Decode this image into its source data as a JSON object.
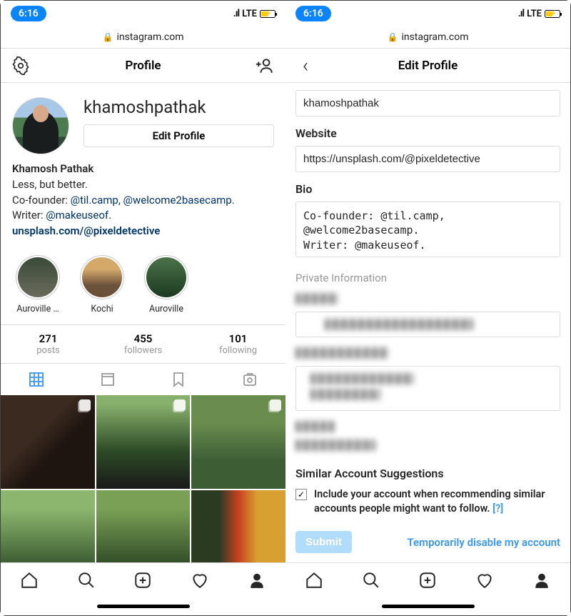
{
  "status_bar": {
    "time": "6:16",
    "network": "LTE",
    "signal": ".ıl"
  },
  "url_bar": {
    "domain": "instagram.com"
  },
  "left": {
    "nav_title": "Profile",
    "username": "khamoshpathak",
    "edit_button": "Edit Profile",
    "full_name": "Khamosh Pathak",
    "tagline": "Less, but better.",
    "cofounder_prefix": "Co-founder: ",
    "cofounder_link1": "@til.camp",
    "cofounder_sep": ", ",
    "cofounder_link2": "@welcome2basecamp",
    "cofounder_period": ".",
    "writer_prefix": "Writer: ",
    "writer_link": "@makeuseof",
    "writer_period": ".",
    "website_link": "unsplash.com/@pixeldetective",
    "highlights": [
      {
        "label": "Auroville …"
      },
      {
        "label": "Kochi"
      },
      {
        "label": "Auroville"
      }
    ],
    "stats": {
      "posts": {
        "value": "271",
        "label": "posts"
      },
      "followers": {
        "value": "455",
        "label": "followers"
      },
      "following": {
        "value": "101",
        "label": "following"
      }
    }
  },
  "right": {
    "nav_title": "Edit Profile",
    "username_value": "khamoshpathak",
    "website_label": "Website",
    "website_value": "https://unsplash.com/@pixeldetective",
    "bio_label": "Bio",
    "bio_value": "Co-founder: @til.camp, @welcome2basecamp.\nWriter: @makeuseof.",
    "private_section": "Private Information",
    "sas_title": "Similar Account Suggestions",
    "sas_text": "Include your account when recommending similar accounts people might want to follow.  ",
    "sas_help": "[?]",
    "submit": "Submit",
    "disable": "Temporarily disable my account"
  }
}
